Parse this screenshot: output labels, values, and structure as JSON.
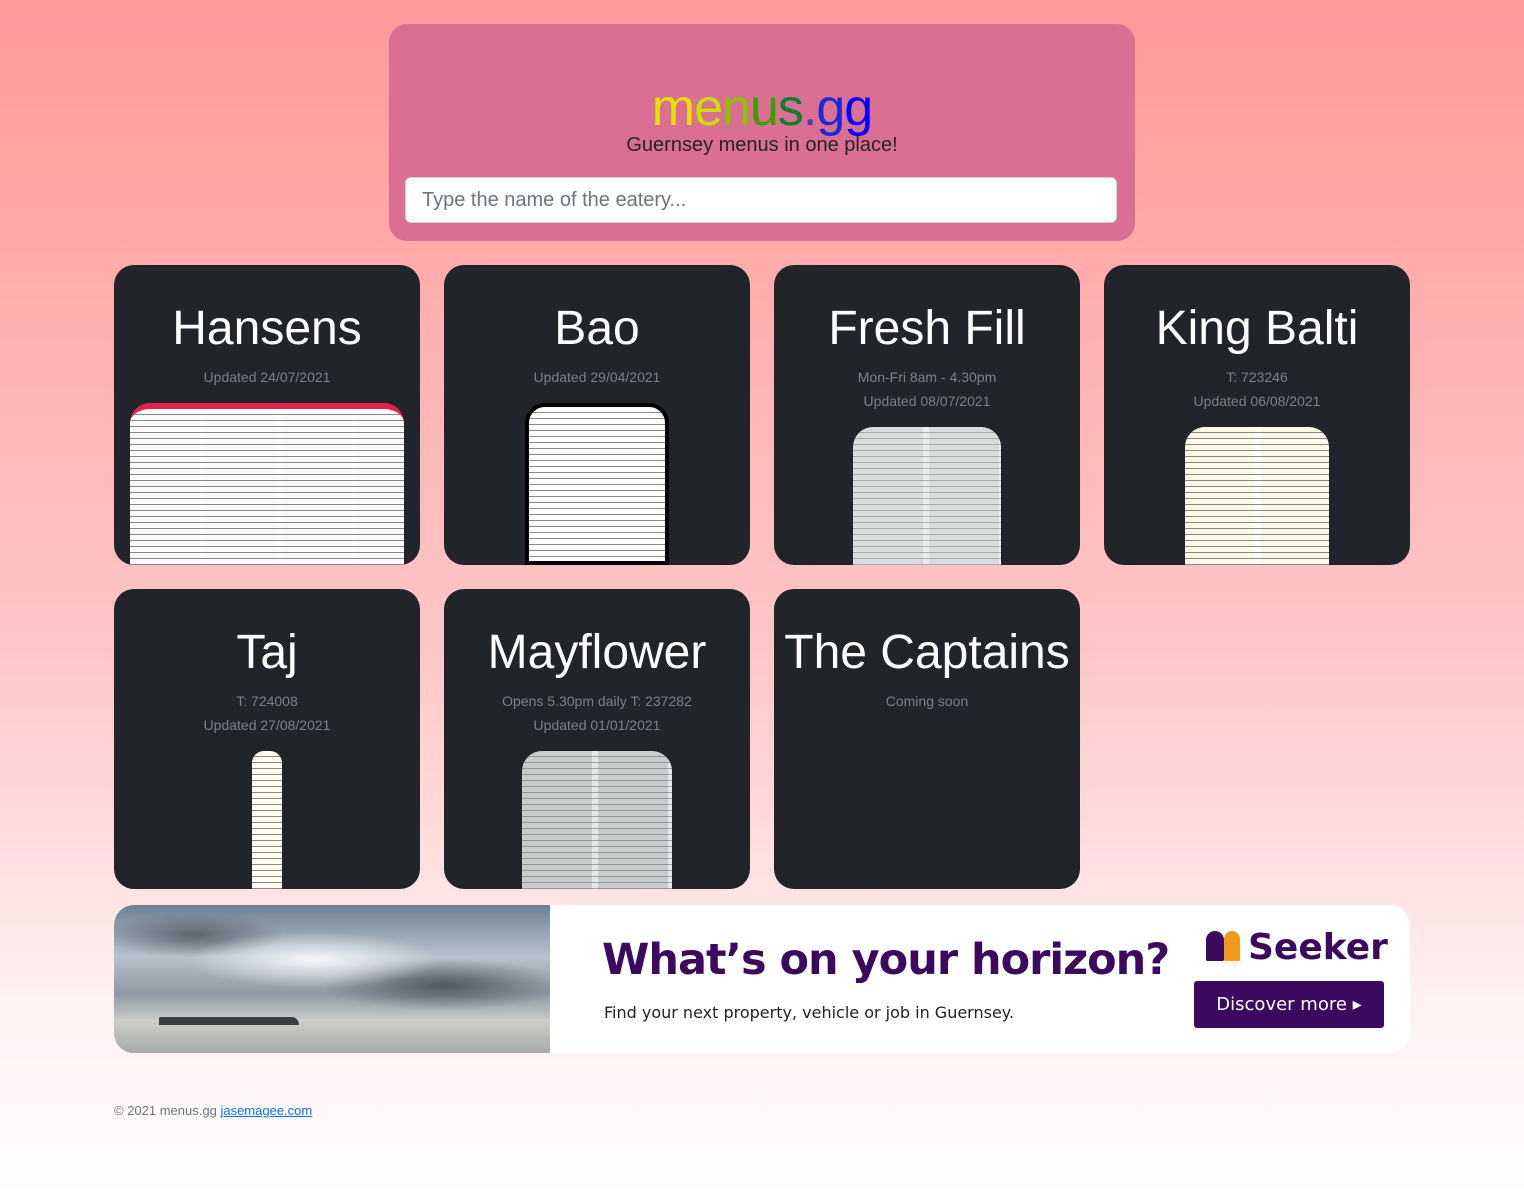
{
  "header": {
    "logo_parts": [
      "m",
      "e",
      "n",
      "u",
      "s",
      ".",
      "g",
      "g"
    ],
    "logo_colors": [
      "#e8e000",
      "#c6e000",
      "#8cc000",
      "#3aa000",
      "#0a7f30",
      "#2f4fa8",
      "#1a28d8",
      "#0000ff"
    ],
    "tagline": "Guernsey menus in one place!",
    "search_placeholder": "Type the name of the eatery..."
  },
  "eateries": [
    {
      "name": "Hansens",
      "lines": [
        "Updated 24/07/2021"
      ]
    },
    {
      "name": "Bao",
      "lines": [
        "Updated 29/04/2021"
      ]
    },
    {
      "name": "Fresh Fill",
      "lines": [
        "Mon-Fri 8am - 4.30pm",
        "Updated 08/07/2021"
      ]
    },
    {
      "name": "King Balti",
      "lines": [
        "T: 723246",
        "Updated 06/08/2021"
      ]
    },
    {
      "name": "Taj",
      "lines": [
        "T: 724008",
        "Updated 27/08/2021"
      ]
    },
    {
      "name": "Mayflower",
      "lines": [
        "Opens 5.30pm daily T: 237282",
        "Updated 01/01/2021"
      ]
    },
    {
      "name": "The Captains",
      "lines": [
        "Coming soon"
      ]
    }
  ],
  "ad": {
    "headline": "What’s on your horizon?",
    "subtext": "Find your next property, vehicle or job in Guernsey.",
    "brand": "Seeker",
    "cta": "Discover more ▸"
  },
  "footer": {
    "copyright": "© 2021 menus.gg",
    "link": "jasemagee.com"
  }
}
